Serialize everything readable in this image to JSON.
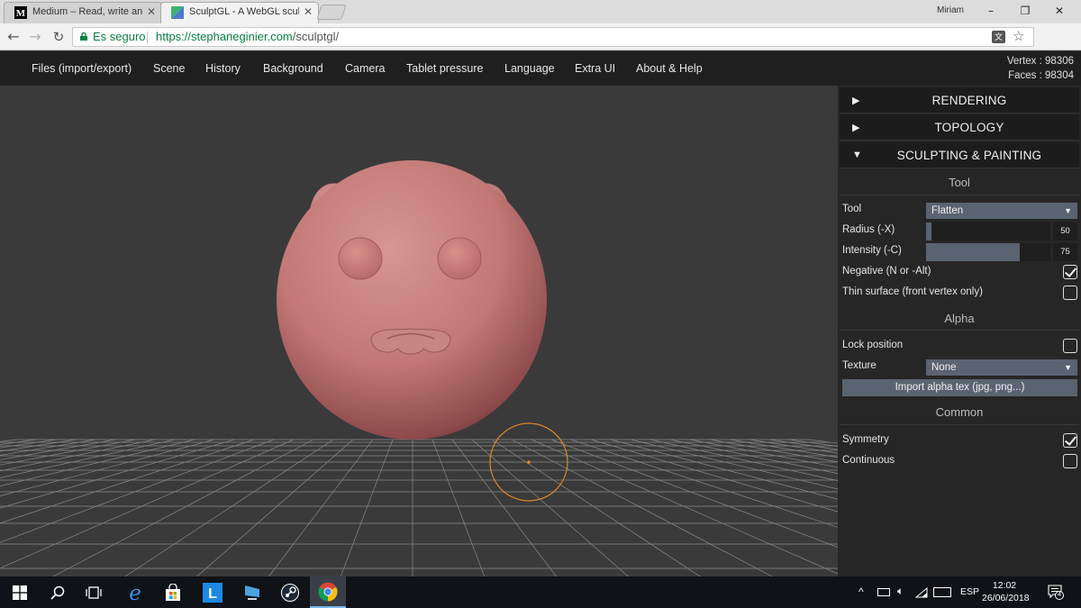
{
  "browser": {
    "tabs": [
      {
        "title": "Medium – Read, write an",
        "favicon": "medium-logo",
        "active": false
      },
      {
        "title": "SculptGL - A WebGL sculp",
        "favicon": "sculptgl-logo",
        "active": true
      }
    ],
    "user": "Miriam",
    "window_controls": {
      "minimize": "–",
      "maximize": "❐",
      "close": "✕"
    },
    "secure_label": "Es seguro",
    "url_host": "https://stephaneginier.com",
    "url_path": "/sculptgl/",
    "translate_glyph": "文"
  },
  "app": {
    "menu": [
      "Files (import/export)",
      "Scene",
      "History",
      "Background",
      "Camera",
      "Tablet pressure",
      "Language",
      "Extra UI",
      "About & Help"
    ],
    "stats": {
      "vertex": "Vertex : 98306",
      "faces": "Faces : 98304"
    }
  },
  "panel": {
    "folders": [
      {
        "title": "RENDERING",
        "arrow": "▶"
      },
      {
        "title": "TOPOLOGY",
        "arrow": "▶"
      },
      {
        "title": "SCULPTING & PAINTING",
        "arrow": "▼"
      }
    ],
    "tool_section": "Tool",
    "tool": {
      "label": "Tool",
      "value": "Flatten",
      "caret": "▼"
    },
    "radius": {
      "label": "Radius (-X)",
      "value": "50",
      "fraction": 0.04
    },
    "intensity": {
      "label": "Intensity (-C)",
      "value": "75",
      "fraction": 0.75
    },
    "negative": {
      "label": "Negative (N or -Alt)",
      "checked": true
    },
    "thin_surface": {
      "label": "Thin surface (front vertex only)",
      "checked": false
    },
    "alpha_section": "Alpha",
    "lock_position": {
      "label": "Lock position",
      "checked": false
    },
    "texture": {
      "label": "Texture",
      "value": "None",
      "caret": "▼"
    },
    "import_alpha": "Import alpha tex (jpg, png...)",
    "common_section": "Common",
    "symmetry": {
      "label": "Symmetry",
      "checked": true
    },
    "continuous": {
      "label": "Continuous",
      "checked": false
    }
  },
  "taskbar": {
    "lang": "ESP",
    "time": "12:02",
    "date": "26/06/2018",
    "notifications": "4"
  },
  "colors": {
    "app_bar": "#1f1f1f",
    "viewport": "#3a3a3a",
    "panel": "#262626",
    "control": "#5a6372",
    "model": "#c17876",
    "brush_ring": "#e0882a"
  }
}
